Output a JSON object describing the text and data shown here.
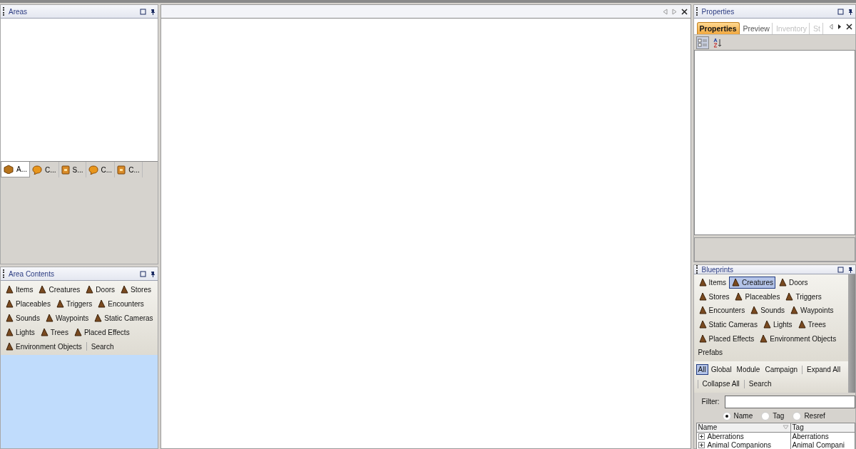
{
  "areas_panel": {
    "title": "Areas",
    "tabs": [
      {
        "label": "A...",
        "selected": true,
        "kind": "box"
      },
      {
        "label": "C...",
        "selected": false,
        "kind": "bubble"
      },
      {
        "label": "S...",
        "selected": false,
        "kind": "book"
      },
      {
        "label": "C...",
        "selected": false,
        "kind": "bubble"
      },
      {
        "label": "C...",
        "selected": false,
        "kind": "book"
      }
    ]
  },
  "area_contents": {
    "title": "Area Contents",
    "rows": [
      [
        {
          "label": "Items",
          "kind": "object"
        },
        {
          "label": "Creatures",
          "kind": "object"
        },
        {
          "label": "Doors",
          "kind": "object"
        },
        {
          "label": "Stores",
          "kind": "object"
        }
      ],
      [
        {
          "label": "Placeables",
          "kind": "object"
        },
        {
          "label": "Triggers",
          "kind": "object"
        },
        {
          "label": "Encounters",
          "kind": "object"
        }
      ],
      [
        {
          "label": "Sounds",
          "kind": "object"
        },
        {
          "label": "Waypoints",
          "kind": "object"
        },
        {
          "label": "Static Cameras",
          "kind": "object"
        }
      ],
      [
        {
          "label": "Lights",
          "kind": "object"
        },
        {
          "label": "Trees",
          "kind": "object"
        },
        {
          "label": "Placed Effects",
          "kind": "object"
        }
      ],
      [
        {
          "label": "Environment Objects",
          "kind": "object"
        },
        {
          "label": "Search",
          "kind": "action"
        }
      ]
    ]
  },
  "properties": {
    "title": "Properties",
    "tabs": [
      {
        "label": "Properties",
        "selected": true,
        "disabled": false
      },
      {
        "label": "Preview",
        "selected": false,
        "disabled": false
      },
      {
        "label": "Inventory",
        "selected": false,
        "disabled": true
      },
      {
        "label": "St",
        "selected": false,
        "disabled": true
      }
    ]
  },
  "blueprints": {
    "title": "Blueprints",
    "rows": [
      [
        {
          "label": "Items",
          "selected": false
        },
        {
          "label": "Creatures",
          "selected": true
        },
        {
          "label": "Doors",
          "selected": false
        }
      ],
      [
        {
          "label": "Stores",
          "selected": false
        },
        {
          "label": "Placeables",
          "selected": false
        },
        {
          "label": "Triggers",
          "selected": false
        }
      ],
      [
        {
          "label": "Encounters",
          "selected": false
        },
        {
          "label": "Sounds",
          "selected": false
        },
        {
          "label": "Waypoints",
          "selected": false
        }
      ],
      [
        {
          "label": "Static Cameras",
          "selected": false
        },
        {
          "label": "Lights",
          "selected": false
        },
        {
          "label": "Trees",
          "selected": false
        }
      ],
      [
        {
          "label": "Placed Effects",
          "selected": false
        },
        {
          "label": "Environment Objects",
          "selected": false
        }
      ]
    ],
    "prefabs_label": "Prefabs",
    "scope_rows": [
      [
        {
          "label": "All",
          "selected": true,
          "kind": "scope"
        },
        {
          "label": "Global",
          "selected": false,
          "kind": "scope"
        },
        {
          "label": "Module",
          "selected": false,
          "kind": "scope"
        },
        {
          "label": "Campaign",
          "selected": false,
          "kind": "scope"
        },
        {
          "label": "Expand All",
          "kind": "action"
        }
      ],
      [
        {
          "label": "Collapse All",
          "kind": "action"
        },
        {
          "label": "Search",
          "kind": "action"
        }
      ]
    ],
    "filter": {
      "label": "Filter:"
    },
    "search_by": [
      {
        "label": "Name",
        "selected": true
      },
      {
        "label": "Tag",
        "selected": false
      },
      {
        "label": "Resref",
        "selected": false
      }
    ],
    "table": {
      "columns": [
        "Name",
        "Tag"
      ],
      "rows": [
        {
          "name": "Aberrations",
          "tag": "Aberrations",
          "expanded": false
        },
        {
          "name": "Animal Companions",
          "tag": "Animal Compani",
          "expanded": false
        }
      ]
    }
  }
}
